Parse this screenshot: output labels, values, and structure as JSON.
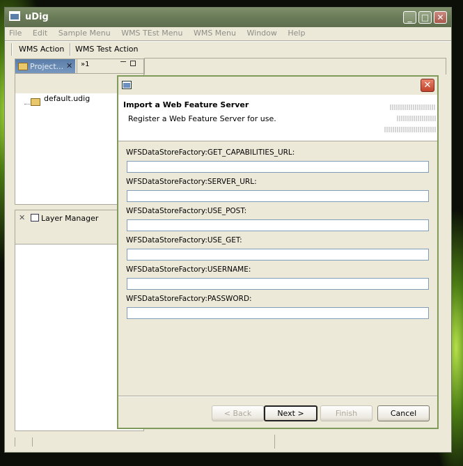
{
  "app": {
    "title": "uDig",
    "min_glyph": "_",
    "max_glyph": "□",
    "close_glyph": "✕"
  },
  "menu": [
    "File",
    "Edit",
    "Sample Menu",
    "WMS TEst Menu",
    "WMS Menu",
    "Window",
    "Help"
  ],
  "toolbar": {
    "wms_action": "WMS Action",
    "wms_test_action": "WMS Test Action"
  },
  "projects_pane": {
    "tab_label": "Project...",
    "tab_close": "✕",
    "tab2_label": "»1",
    "tree_item": "default.udig"
  },
  "layer_pane": {
    "close": "✕",
    "title": "Layer Manager"
  },
  "dialog": {
    "close": "✕",
    "heading": "Import a Web Feature Server",
    "description": "Register a Web Feature Server for use.",
    "fields": [
      {
        "label": "WFSDataStoreFactory:GET_CAPABILITIES_URL:",
        "value": ""
      },
      {
        "label": "WFSDataStoreFactory:SERVER_URL:",
        "value": ""
      },
      {
        "label": "WFSDataStoreFactory:USE_POST:",
        "value": ""
      },
      {
        "label": "WFSDataStoreFactory:USE_GET:",
        "value": ""
      },
      {
        "label": "WFSDataStoreFactory:USERNAME:",
        "value": ""
      },
      {
        "label": "WFSDataStoreFactory:PASSWORD:",
        "value": ""
      }
    ],
    "buttons": {
      "back": "< Back",
      "next": "Next >",
      "finish": "Finish",
      "cancel": "Cancel"
    }
  }
}
